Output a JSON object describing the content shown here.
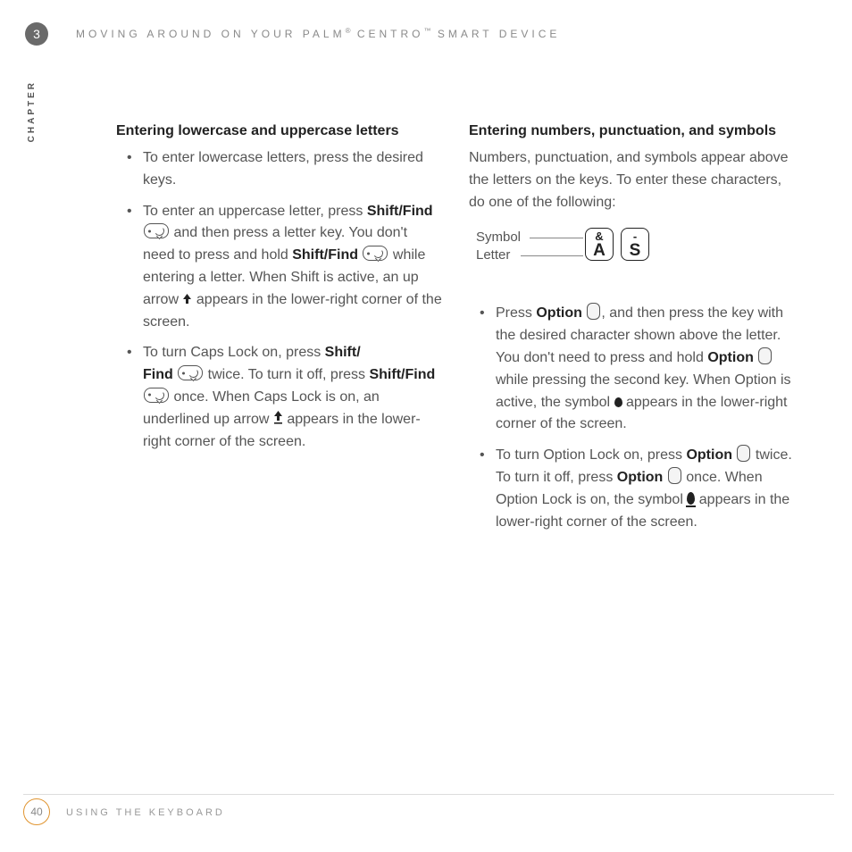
{
  "header": {
    "chapter_number": "3",
    "running": "MOVING AROUND ON YOUR PALM",
    "reg": "®",
    "product": " CENTRO",
    "tm": "™",
    "suffix": " SMART DEVICE",
    "chapter_label": "CHAPTER"
  },
  "left": {
    "heading": "Entering lowercase and uppercase letters",
    "b1": "To enter lowercase letters, press the desired keys.",
    "b2a": "To enter an uppercase letter, press ",
    "shiftfind": "Shift/Find",
    "b2b": " and then press a letter key. You don't need to press and hold ",
    "b2c": " while entering a letter. When Shift is active, an up arrow ",
    "b2d": " appears in the lower-right corner of the screen.",
    "b3a": "To turn Caps Lock on, press ",
    "shiftfind_split": "Shift/ Find",
    "b3b": " twice. To turn it off, press ",
    "b3c": " once. When Caps Lock is on, an underlined up arrow ",
    "b3d": " appears in the lower-right corner of the screen."
  },
  "right": {
    "heading": "Entering numbers, punctuation, and symbols",
    "intro": "Numbers, punctuation, and symbols appear above the letters on the keys. To enter these characters, do one of the following:",
    "diagram": {
      "label_symbol": "Symbol",
      "label_letter": "Letter",
      "key1_sym": "&",
      "key1_ltr": "A",
      "key2_sym": "-",
      "key2_ltr": "S"
    },
    "b1a": "Press ",
    "option": "Option",
    "b1b": ", and then press the key with the desired character shown above the letter. You don't need to press and hold ",
    "b1c": " while pressing the second key. When Option is active, the symbol ",
    "b1d": " appears in the lower-right corner of the screen.",
    "b2a": "To turn Option Lock on, press ",
    "b2b": " twice. To turn it off, press ",
    "b2c": " once. When Option Lock is on, the symbol ",
    "b2d": " appears in the lower-right corner of the screen."
  },
  "footer": {
    "page": "40",
    "text": "USING THE KEYBOARD"
  }
}
